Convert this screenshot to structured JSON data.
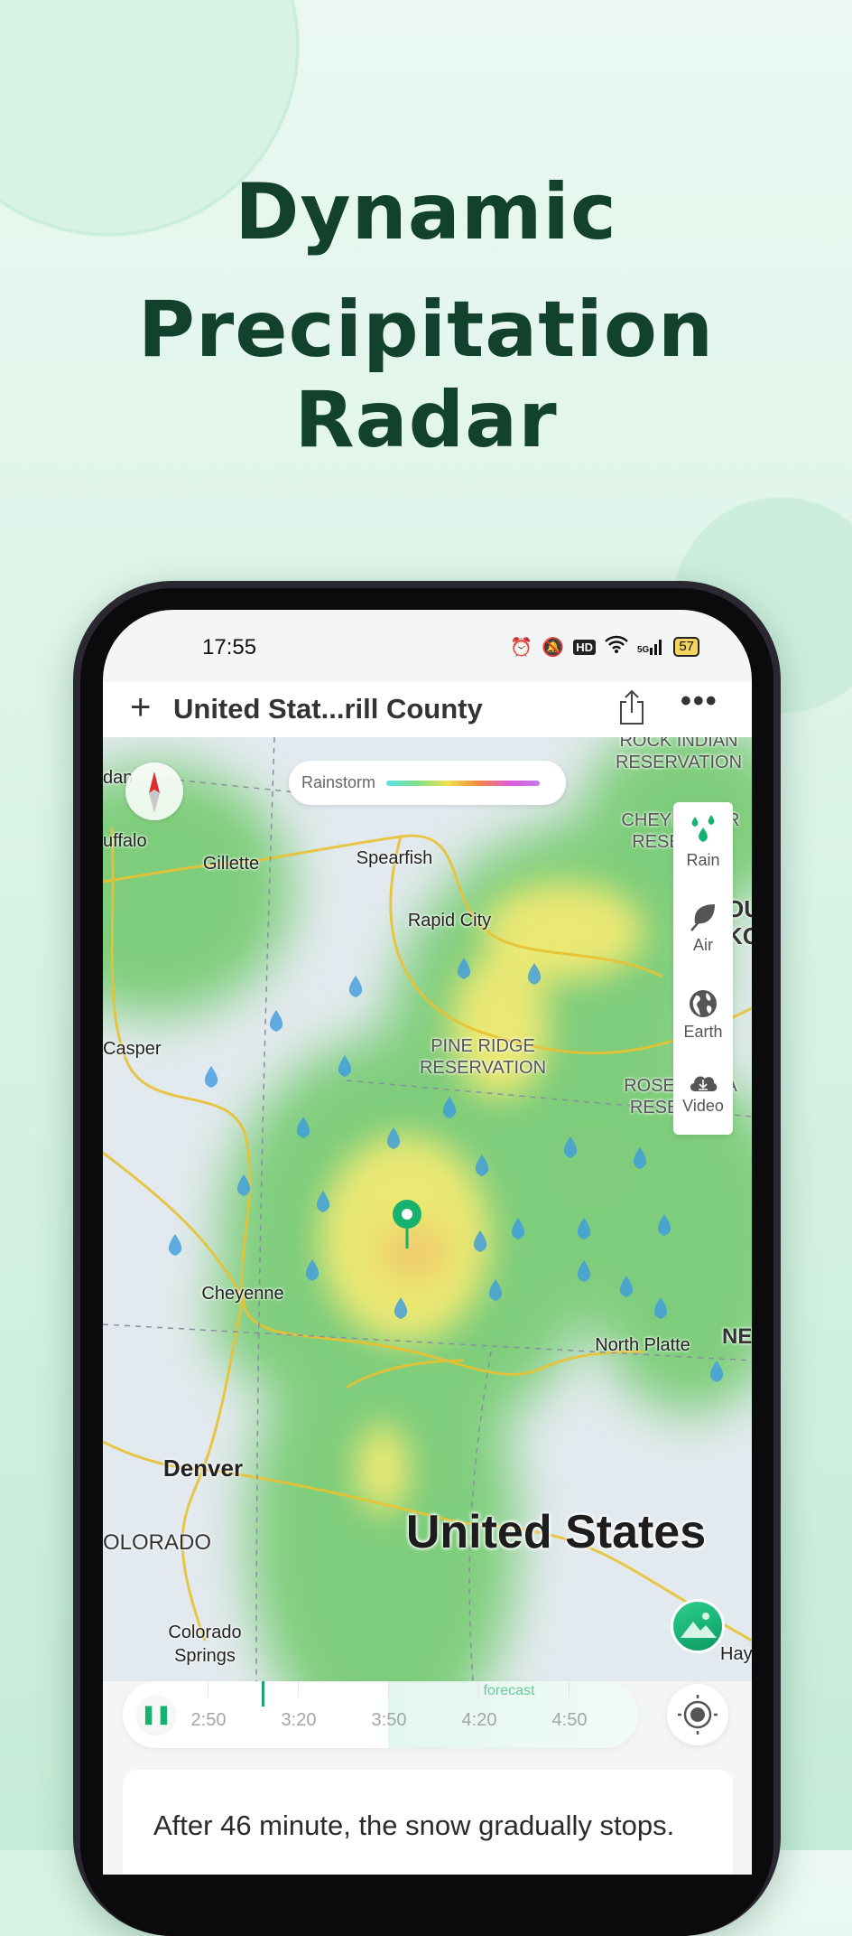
{
  "headline": {
    "line1": "Dynamic",
    "line2": "Precipitation Radar"
  },
  "status_bar": {
    "time": "17:55",
    "network": "5G",
    "battery": "57",
    "hd_label": "HD"
  },
  "header": {
    "location": "United Stat...rill County",
    "add_icon": "plus-icon",
    "share_icon": "share-icon",
    "more_icon": "more-icon"
  },
  "legend": {
    "label": "Rainstorm",
    "colors": [
      "#5ee1e8",
      "#7fe08a",
      "#f0e34f",
      "#f28a3c",
      "#e05ad8"
    ]
  },
  "side_menu": [
    {
      "label": "Rain",
      "icon": "rain-drops-icon",
      "active": true
    },
    {
      "label": "Air",
      "icon": "leaf-icon"
    },
    {
      "label": "Earth",
      "icon": "globe-icon"
    },
    {
      "label": "Video",
      "icon": "cloud-download-icon"
    }
  ],
  "map_labels": {
    "sheridan": "dan",
    "buffalo": "uffalo",
    "gillette": "Gillette",
    "spearfish": "Spearfish",
    "rapid_city": "Rapid City",
    "casper": "Casper",
    "pine_ridge": "PINE RIDGE\nRESERVATION",
    "rock_indian": "ROCK INDIAN\nRESERVATION",
    "cheyenne_res": "CHEYENNE R\nRESERV  N",
    "rosebud": "ROSEB    DIA\nRESE     ON",
    "south_dakota": "OU\nKO",
    "cheyenne": "Cheyenne",
    "north_platte": "North Platte",
    "nebraska": "NE",
    "denver": "Denver",
    "colorado": "OLORADO",
    "colorado_springs": "Colorado\nSprings",
    "country": "United States",
    "hays": "Hay"
  },
  "timeline": {
    "times": [
      "2:50",
      "3:20",
      "3:50",
      "4:20",
      "4:50"
    ],
    "forecast_label": "forecast",
    "state": "playing"
  },
  "summary": "After 46 minute, the snow gradually stops.",
  "accent_color": "#17b26f"
}
